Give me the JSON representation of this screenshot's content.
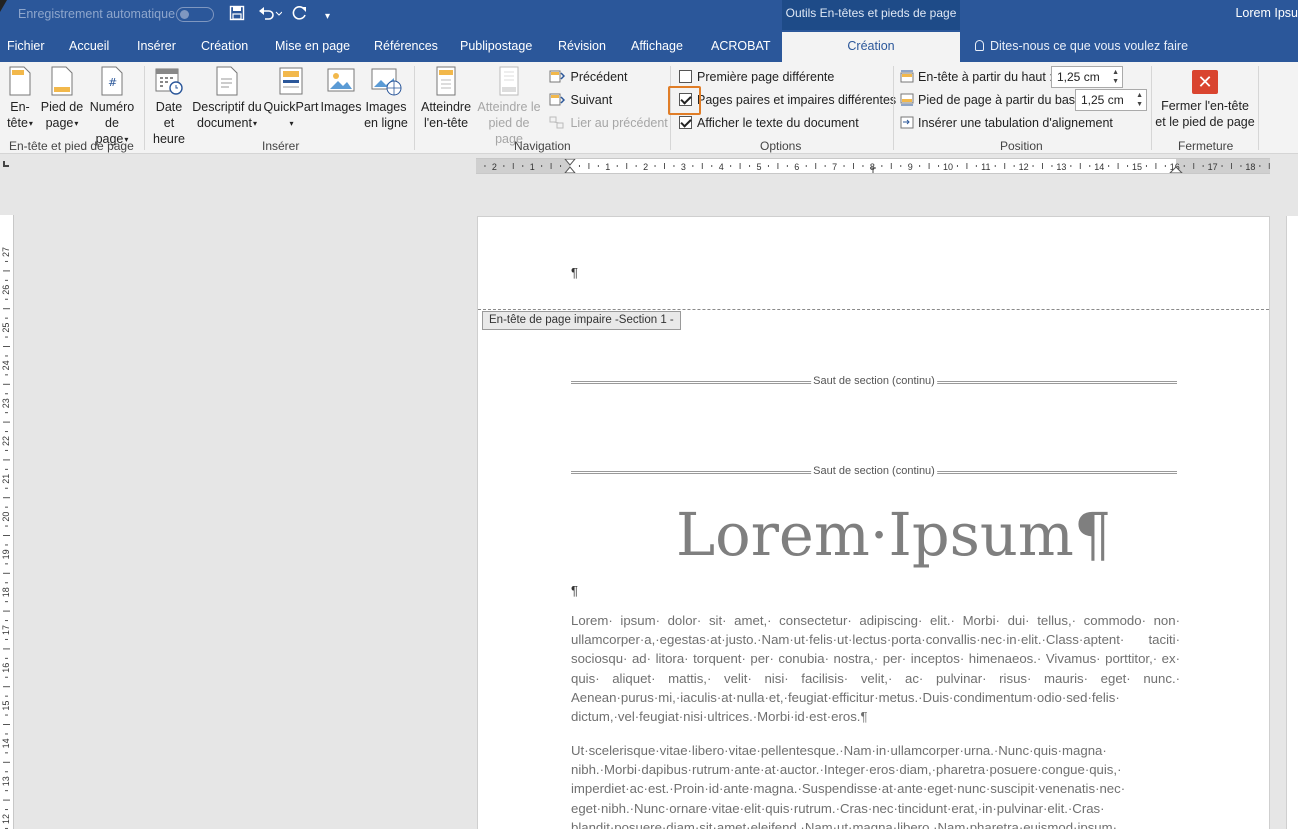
{
  "titlebar": {
    "autosave_label": "Enregistrement automatique",
    "context_group": "Outils En-têtes et pieds de page",
    "doc_title": "Lorem Ipsu"
  },
  "tabs": {
    "items": [
      "Fichier",
      "Accueil",
      "Insérer",
      "Création",
      "Mise en page",
      "Références",
      "Publipostage",
      "Révision",
      "Affichage",
      "ACROBAT"
    ],
    "active": "Création",
    "tellme": "Dites-nous ce que vous voulez faire"
  },
  "ribbon": {
    "header_footer_group": {
      "label": "En-tête et pied de page",
      "header_btn": [
        "En-",
        "tête"
      ],
      "footer_btn": [
        "Pied de",
        "page"
      ],
      "page_number_btn": [
        "Numéro",
        "de page"
      ]
    },
    "insert_group": {
      "label": "Insérer",
      "date_btn": [
        "Date et",
        "heure"
      ],
      "docinfo_btn": [
        "Descriptif du",
        "document"
      ],
      "quickpart_btn": "QuickPart",
      "images_btn": "Images",
      "online_images_btn": [
        "Images",
        "en ligne"
      ]
    },
    "navigation_group": {
      "label": "Navigation",
      "goto_header_btn": [
        "Atteindre",
        "l'en-tête"
      ],
      "goto_footer_btn": [
        "Atteindre le",
        "pied de page"
      ],
      "previous": "Précédent",
      "next": "Suivant",
      "link_previous": "Lier au précédent"
    },
    "options_group": {
      "label": "Options",
      "first_page": {
        "label": "Première page différente",
        "checked": false
      },
      "odd_even": {
        "label": "Pages paires et impaires différentes",
        "checked": true
      },
      "show_text": {
        "label": "Afficher le texte du document",
        "checked": true
      }
    },
    "position_group": {
      "label": "Position",
      "header_from_top": {
        "label": "En-tête à partir du haut :",
        "value": "1,25 cm"
      },
      "footer_from_bottom": {
        "label": "Pied de page à partir du bas :",
        "value": "1,25 cm"
      },
      "insert_tab": "Insérer une tabulation d'alignement"
    },
    "close_group": {
      "label": "Fermeture",
      "close_btn": [
        "Fermer l'en-tête",
        "et le pied de page"
      ]
    }
  },
  "ruler": {
    "h_labels": [
      "2",
      "1",
      "1",
      "2",
      "3",
      "4",
      "5",
      "6",
      "7",
      "8",
      "9",
      "10",
      "11",
      "12",
      "13",
      "14",
      "15",
      "16",
      "17",
      "18"
    ],
    "v_labels": [
      "27",
      "26",
      "25",
      "24",
      "23",
      "22",
      "21",
      "20",
      "19",
      "18",
      "17",
      "16",
      "15",
      "14",
      "13",
      "12"
    ]
  },
  "document": {
    "header_pilcrow": "¶",
    "header_tag": "En-tête de page impaire -Section 1 -",
    "section_break": "Saut de section (continu)",
    "title": "Lorem·Ipsum¶",
    "empty_para": "¶",
    "para1": "Lorem· ipsum· dolor· sit· amet,· consectetur· adipiscing· elit.· Morbi· dui· tellus,· commodo· non· ullamcorper·a,·egestas·at·justo.·Nam·ut·felis·ut·lectus·porta·convallis·nec·in·elit.·Class·aptent· taciti· sociosqu· ad· litora· torquent· per· conubia· nostra,· per· inceptos· himenaeos.· Vivamus· porttitor,· ex· quis· aliquet· mattis,· velit· nisi· facilisis· velit,· ac· pulvinar· risus· mauris· eget· nunc.· Aenean·purus·mi,·iaculis·at·nulla·et,·feugiat·efficitur·metus.·Duis·condimentum·odio·sed·felis· dictum,·vel·feugiat·nisi·ultrices.·Morbi·id·est·eros.¶",
    "para2": "Ut·scelerisque·vitae·libero·vitae·pellentesque.·Nam·in·ullamcorper·urna.·Nunc·quis·magna· nibh.·Morbi·dapibus·rutrum·ante·at·auctor.·Integer·eros·diam,·pharetra·posuere·congue·quis,· imperdiet·ac·est.·Proin·id·ante·magna.·Suspendisse·at·ante·eget·nunc·suscipit·venenatis·nec· eget·nibh.·Nunc·ornare·vitae·elit·quis·rutrum.·Cras·nec·tincidunt·erat,·in·pulvinar·elit.·Cras· blandit·posuere·diam·sit·amet·eleifend.·Nam·ut·magna·libero.·Nam·pharetra·euismod·ipsum·"
  },
  "colors": {
    "word_blue": "#2b579a",
    "focus_orange": "#e07d27",
    "close_red": "#d9442f"
  }
}
